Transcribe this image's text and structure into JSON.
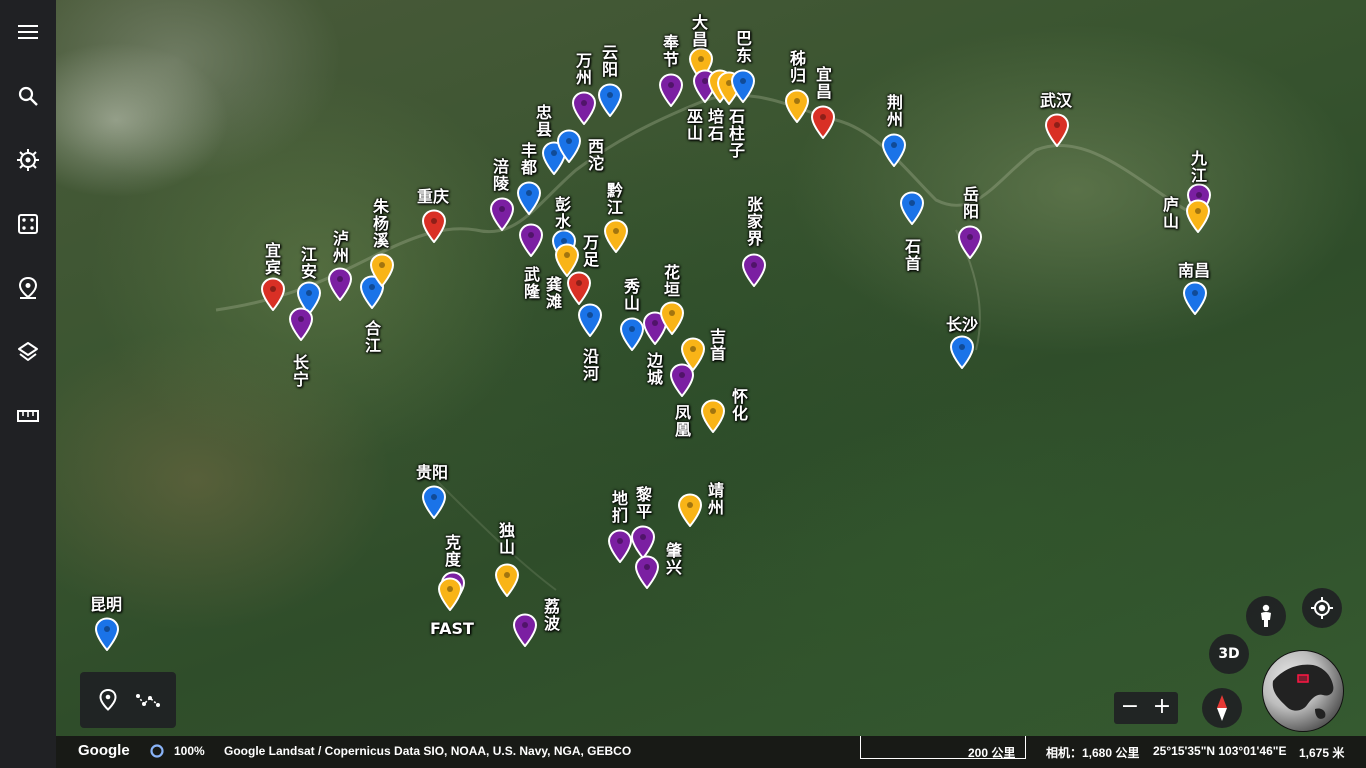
{
  "sidebar": {
    "items": [
      {
        "name": "menu-icon"
      },
      {
        "name": "search-icon"
      },
      {
        "name": "voyager-icon"
      },
      {
        "name": "feeling-lucky-icon"
      },
      {
        "name": "projects-icon"
      },
      {
        "name": "map-style-icon"
      },
      {
        "name": "measure-icon"
      }
    ]
  },
  "colors": {
    "red": "#d93025",
    "blue": "#1a73e8",
    "purple": "#7b1fa2",
    "yellow": "#f9b417"
  },
  "places": [
    {
      "label": "昆明",
      "color": "blue"
    },
    {
      "label": "宜宾",
      "color": "red"
    },
    {
      "label": "江安",
      "color": "blue"
    },
    {
      "label": "长宁",
      "color": "purple"
    },
    {
      "label": "泸州",
      "color": "purple"
    },
    {
      "label": "合江",
      "color": "blue"
    },
    {
      "label": "朱杨溪",
      "color": "yellow"
    },
    {
      "label": "重庆",
      "color": "red"
    },
    {
      "label": "涪陵",
      "color": "purple"
    },
    {
      "label": "丰都",
      "color": "blue"
    },
    {
      "label": "忠县",
      "color": "blue"
    },
    {
      "label": "万州",
      "color": "purple"
    },
    {
      "label": "云阳",
      "color": "blue"
    },
    {
      "label": "西沱",
      "color": "blue"
    },
    {
      "label": "武隆",
      "color": "purple"
    },
    {
      "label": "彭水",
      "color": "blue"
    },
    {
      "label": "万足",
      "color": "yellow"
    },
    {
      "label": "龚滩",
      "color": "red"
    },
    {
      "label": "黔江",
      "color": "yellow"
    },
    {
      "label": "沿河",
      "color": "blue"
    },
    {
      "label": "秀山",
      "color": "blue"
    },
    {
      "label": "边城",
      "color": "purple"
    },
    {
      "label": "花垣",
      "color": "yellow"
    },
    {
      "label": "吉首",
      "color": "yellow"
    },
    {
      "label": "凤凰",
      "color": "purple"
    },
    {
      "label": "怀化",
      "color": "yellow"
    },
    {
      "label": "张家界",
      "color": "purple"
    },
    {
      "label": "奉节",
      "color": "purple"
    },
    {
      "label": "大昌",
      "color": "yellow"
    },
    {
      "label": "巫山",
      "color": "purple"
    },
    {
      "label": "培石",
      "color": "yellow"
    },
    {
      "label": "石柱子",
      "color": "yellow"
    },
    {
      "label": "巴东",
      "color": "blue"
    },
    {
      "label": "秭归",
      "color": "yellow"
    },
    {
      "label": "宜昌",
      "color": "red"
    },
    {
      "label": "荆州",
      "color": "blue"
    },
    {
      "label": "石首",
      "color": "blue"
    },
    {
      "label": "岳阳",
      "color": "purple"
    },
    {
      "label": "长沙",
      "color": "blue"
    },
    {
      "label": "武汉",
      "color": "red"
    },
    {
      "label": "九江",
      "color": "purple"
    },
    {
      "label": "庐山",
      "color": "yellow"
    },
    {
      "label": "南昌",
      "color": "blue"
    },
    {
      "label": "贵阳",
      "color": "blue"
    },
    {
      "label": "克度",
      "color": "purple"
    },
    {
      "label": "FAST",
      "color": "yellow"
    },
    {
      "label": "独山",
      "color": "yellow"
    },
    {
      "label": "荔波",
      "color": "purple"
    },
    {
      "label": "地扪",
      "color": "purple"
    },
    {
      "label": "黎平",
      "color": "purple"
    },
    {
      "label": "肇兴",
      "color": "purple"
    },
    {
      "label": "靖州",
      "color": "yellow"
    }
  ],
  "controls": {
    "three_d_label": "3D",
    "zoom_out": "−",
    "zoom_in": "+"
  },
  "status": {
    "logo": "Google",
    "loading": "100%",
    "credits": "Google  Landsat / Copernicus  Data SIO, NOAA, U.S. Navy, NGA, GEBCO",
    "scale": "200 公里",
    "camera": "相机：1,680 公里",
    "coords": "25°15'35\"N 103°01'46\"E",
    "elevation": "1,675 米"
  }
}
